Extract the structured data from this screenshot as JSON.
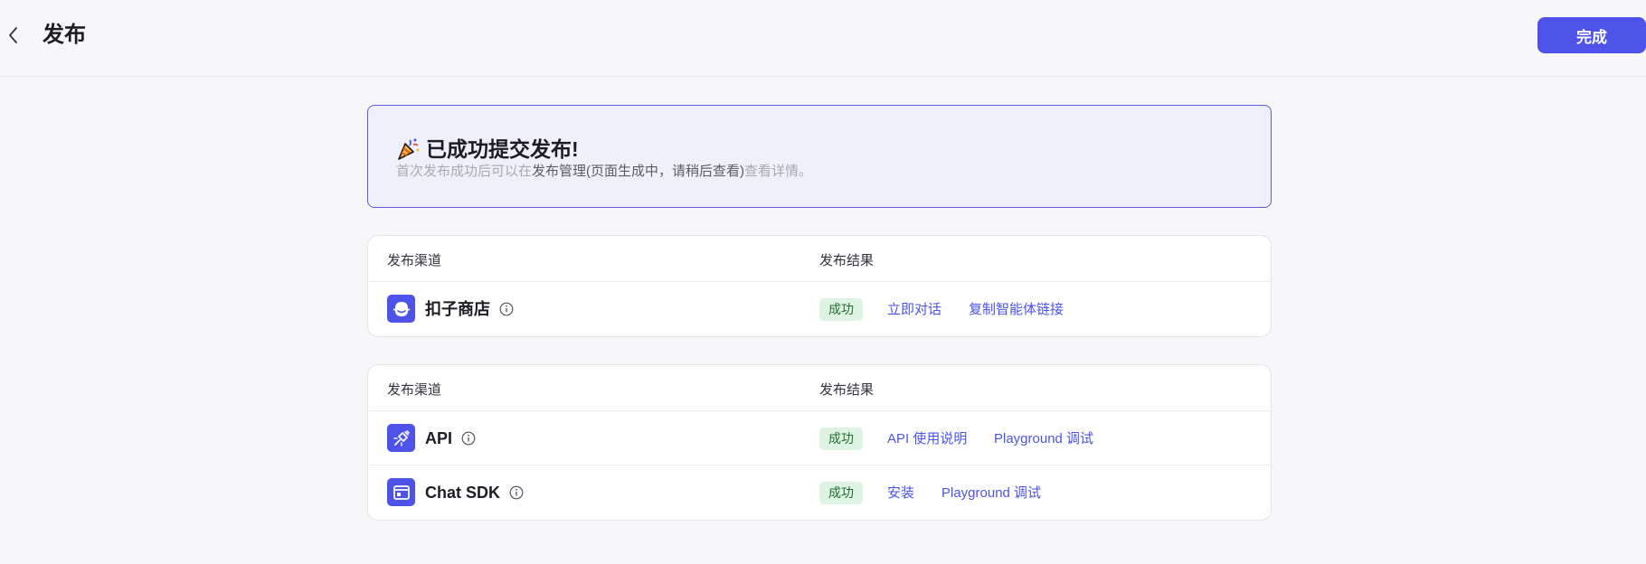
{
  "header": {
    "title": "发布",
    "done_label": "完成"
  },
  "banner": {
    "title": "已成功提交发布!",
    "desc_prefix": "首次发布成功后可以在",
    "desc_link": "发布管理(页面生成中，请稍后查看)",
    "desc_suffix": "查看详情。"
  },
  "table1": {
    "col_channel": "发布渠道",
    "col_result": "发布结果",
    "rows": [
      {
        "channel": "扣子商店",
        "icon": "store-icon",
        "status": "成功",
        "actions": [
          "立即对话",
          "复制智能体链接"
        ]
      }
    ]
  },
  "table2": {
    "col_channel": "发布渠道",
    "col_result": "发布结果",
    "rows": [
      {
        "channel": "API",
        "icon": "api-plug-icon",
        "status": "成功",
        "actions": [
          "API 使用说明",
          "Playground 调试"
        ]
      },
      {
        "channel": "Chat SDK",
        "icon": "sdk-window-icon",
        "status": "成功",
        "actions": [
          "安装",
          "Playground 调试"
        ]
      }
    ]
  },
  "colors": {
    "accent": "#4d53e8",
    "success_bg": "#dff3e3",
    "success_text": "#1f6e35",
    "banner_bg": "#eff0fb"
  }
}
